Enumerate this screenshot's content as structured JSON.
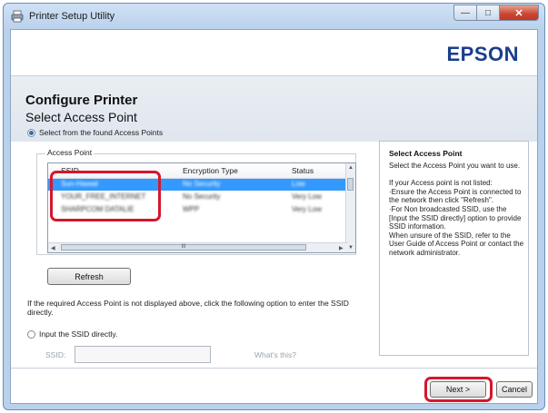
{
  "window": {
    "title": "Printer Setup Utility",
    "icons": {
      "app": "printer-icon",
      "minimize": "minimize-icon",
      "maximize": "maximize-icon",
      "close": "close-icon"
    }
  },
  "brand": {
    "logo_text": "EPSON",
    "color": "#1b3d8c"
  },
  "page": {
    "title": "Configure Printer"
  },
  "section": {
    "title": "Select Access Point"
  },
  "option_found": {
    "label": "Select from the found Access Points",
    "selected": true
  },
  "access_point_group": {
    "label": "Access Point",
    "columns": [
      "SSID",
      "Encryption Type",
      "Status"
    ],
    "rows": [
      {
        "ssid": "Sun-Hawaii",
        "encryption": "No Security",
        "status": "Low",
        "selected": true
      },
      {
        "ssid": "YOUR_FREE_INTERNET",
        "encryption": "No Security",
        "status": "Very Low",
        "selected": false
      },
      {
        "ssid": "SHARPCOM DATALIE",
        "encryption": "WPP",
        "status": "Very Low",
        "selected": false
      }
    ],
    "hscroll_grip": "III"
  },
  "refresh_button": {
    "label": "Refresh"
  },
  "info_text": "If the required Access Point is not displayed above, click the following option to enter the SSID directly.",
  "option_direct": {
    "label": "Input the SSID directly.",
    "selected": false
  },
  "ssid_field": {
    "label": "SSID:",
    "value": "",
    "help_link": "What's this?"
  },
  "help_panel": {
    "title": "Select Access Point",
    "text": "Select the Access Point you want to use.\n\nIf your Access point is not listed:\n·Ensure the Access Point is connected to the network then click \"Refresh\".\n·For Non broadcasted SSID, use the [Input the SSID directly] option to provide SSID information.\nWhen unsure of the SSID, refer to the User Guide of Access Point or contact the network administrator."
  },
  "footer": {
    "next_label": "Next >",
    "cancel_label": "Cancel"
  },
  "colors": {
    "highlight": "#d6162c",
    "selection": "#3399ff"
  }
}
